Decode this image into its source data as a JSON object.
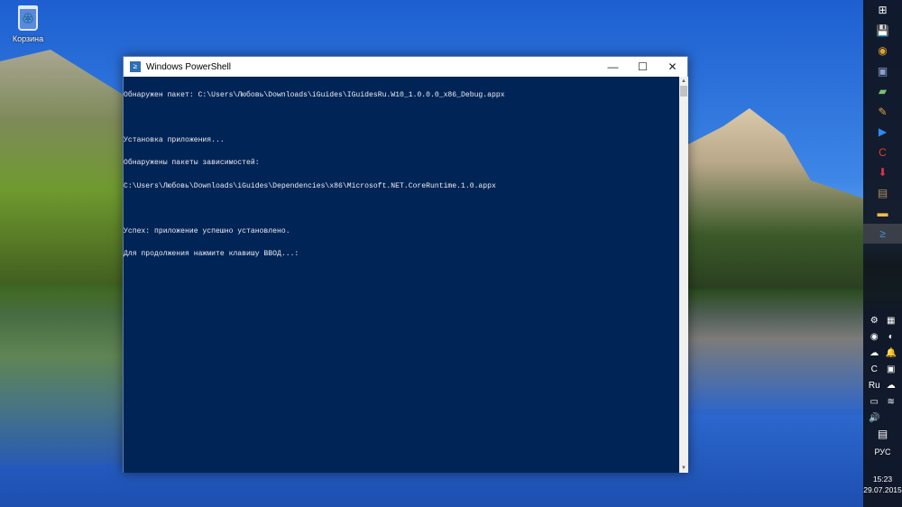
{
  "desktop": {
    "icons": [
      {
        "label": "Корзина",
        "icon": "recycle-bin-icon"
      }
    ]
  },
  "window": {
    "title": "Windows PowerShell",
    "controls": {
      "minimize": "—",
      "maximize": "☐",
      "close": "✕"
    },
    "console_lines": [
      "Обнаружен пакет: C:\\Users\\Любовь\\Downloads\\iGuides\\IGuidesRu.W10_1.0.0.0_x86_Debug.appx",
      "",
      "Установка приложения...",
      "Обнаружены пакеты зависимостей:",
      "C:\\Users\\Любовь\\Downloads\\iGuides\\Dependencies\\x86\\Microsoft.NET.CoreRuntime.1.0.appx",
      "",
      "Успех: приложение успешно установлено.",
      "Для продолжения нажмите клавишу ВВОД...:"
    ]
  },
  "taskbar": {
    "apps": [
      {
        "name": "start",
        "glyph": "⊞",
        "color": "#ffffff"
      },
      {
        "name": "save-app",
        "glyph": "💾",
        "color": "#3050d0"
      },
      {
        "name": "chrome",
        "glyph": "◉",
        "color": "#e0a030"
      },
      {
        "name": "editor",
        "glyph": "▣",
        "color": "#8aa0d0"
      },
      {
        "name": "notes",
        "glyph": "▰",
        "color": "#7ac070"
      },
      {
        "name": "tool",
        "glyph": "✎",
        "color": "#e0a040"
      },
      {
        "name": "player",
        "glyph": "▶",
        "color": "#2a8cf0"
      },
      {
        "name": "ccleaner",
        "glyph": "C",
        "color": "#e04020"
      },
      {
        "name": "downloader",
        "glyph": "⬇",
        "color": "#e03040"
      },
      {
        "name": "monitor",
        "glyph": "▤",
        "color": "#b09060"
      },
      {
        "name": "explorer",
        "glyph": "▬",
        "color": "#f0c040"
      },
      {
        "name": "powershell",
        "glyph": "≥",
        "color": "#4a8fd8"
      }
    ],
    "tray": [
      "⚙",
      "▦",
      "◉",
      "◐",
      "☁",
      "🔔",
      "C",
      "▣",
      "Ru",
      "☁",
      "▭",
      "≋",
      "🔊",
      ""
    ],
    "language": "РУС",
    "time": "15:23",
    "date": "29.07.2015"
  }
}
